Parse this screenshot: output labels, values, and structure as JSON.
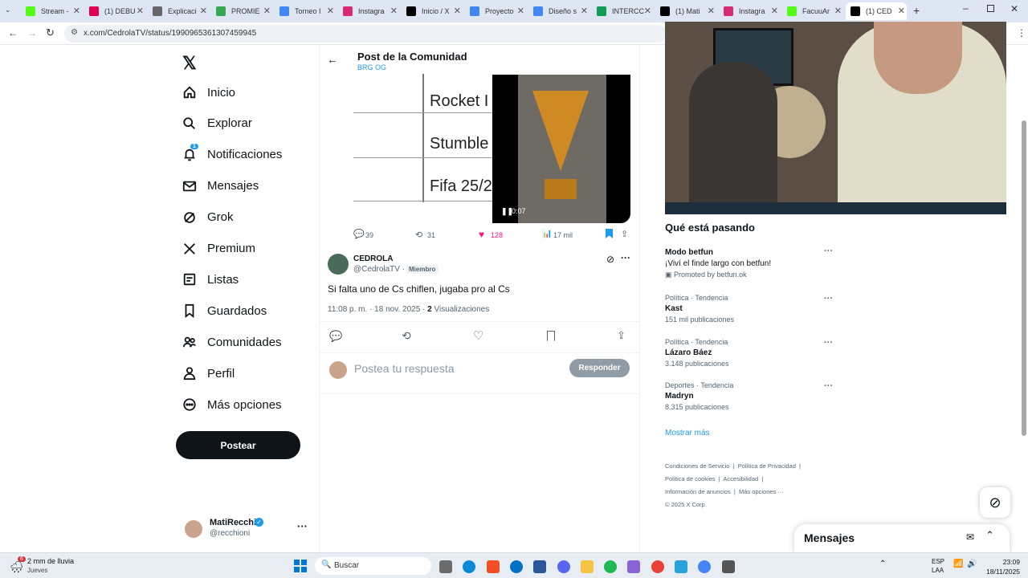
{
  "browser": {
    "tabs": [
      {
        "label": "Stream -",
        "color": "#53fc18"
      },
      {
        "label": "(1) DEBU",
        "color": "#e0004d"
      },
      {
        "label": "Explicaci",
        "color": "#666666"
      },
      {
        "label": "PROMIE",
        "color": "#34a853"
      },
      {
        "label": "Torneo I",
        "color": "#4285f4"
      },
      {
        "label": "Instagra",
        "color": "#d62976"
      },
      {
        "label": "Inicio / X",
        "color": "#000000"
      },
      {
        "label": "Proyecto",
        "color": "#4285f4"
      },
      {
        "label": "Diseño s",
        "color": "#4285f4"
      },
      {
        "label": "INTERCC",
        "color": "#0f9d58"
      },
      {
        "label": "(1) Mati",
        "color": "#000000"
      },
      {
        "label": "Instagra",
        "color": "#d62976"
      },
      {
        "label": "FacuuAr",
        "color": "#53fc18"
      },
      {
        "label": "(1) CED",
        "color": "#000000"
      }
    ],
    "url": "x.com/CedrolaTV/status/1990965361307459945"
  },
  "sidebar": {
    "items": [
      {
        "label": "Inicio",
        "icon": "home-icon"
      },
      {
        "label": "Explorar",
        "icon": "search-icon"
      },
      {
        "label": "Notificaciones",
        "icon": "bell-icon",
        "badge": "1"
      },
      {
        "label": "Mensajes",
        "icon": "mail-icon"
      },
      {
        "label": "Grok",
        "icon": "grok-icon"
      },
      {
        "label": "Premium",
        "icon": "x-icon"
      },
      {
        "label": "Listas",
        "icon": "list-icon"
      },
      {
        "label": "Guardados",
        "icon": "bookmark-icon"
      },
      {
        "label": "Comunidades",
        "icon": "people-icon"
      },
      {
        "label": "Perfil",
        "icon": "person-icon"
      },
      {
        "label": "Más opciones",
        "icon": "more-circle-icon"
      }
    ],
    "post_button": "Postear",
    "account": {
      "name": "MatiRecchi",
      "handle": "@recchioni"
    }
  },
  "header": {
    "title": "Post de la Comunidad",
    "subtitle": "BRG OG"
  },
  "media": {
    "table_rows": [
      "Rocket I",
      "Stumble",
      "Fifa 25/2"
    ],
    "video_time": "0:07"
  },
  "parent_actions": {
    "replies": "39",
    "reposts": "31",
    "likes": "128",
    "views": "17 mil"
  },
  "post": {
    "name": "CEDROLA",
    "handle": "@CedrolaTV",
    "sep": "·",
    "member_badge": "Miembro",
    "text": "Si falta uno de Cs chiflen, jugaba pro al Cs",
    "time": "11:08 p. m. · 18 nov. 2025 ·",
    "views_count": "2",
    "views_label": "Visualizaciones"
  },
  "reply": {
    "placeholder": "Postea tu respuesta",
    "button": "Responder"
  },
  "trends": {
    "title": "Qué está pasando",
    "promo": {
      "name": "Modo betfun",
      "text": "¡Viví el finde largo con betfun!",
      "promoted": "Promoted by betfun.ok"
    },
    "items": [
      {
        "category": "Política · Tendencia",
        "name": "Kast",
        "count": "151 mil publicaciones"
      },
      {
        "category": "Política · Tendencia",
        "name": "Lázaro Báez",
        "count": "3.148 publicaciones"
      },
      {
        "category": "Deportes · Tendencia",
        "name": "Madryn",
        "count": "8.315 publicaciones"
      }
    ],
    "more": "Mostrar más"
  },
  "footer": {
    "links": [
      "Condiciones de Servicio",
      "Política de Privacidad",
      "Política de cookies",
      "Accesibilidad",
      "Información de anuncios",
      "Más opciones ···"
    ],
    "copyright": "© 2025 X Corp."
  },
  "messages_drawer": {
    "title": "Mensajes"
  },
  "taskbar": {
    "weather": "2 mm de lluvia",
    "weather_day": "Jueves",
    "weather_badge": "6",
    "search": "Buscar",
    "lang": "ESP",
    "lang2": "LAA",
    "time": "23:09",
    "date": "18/11/2025"
  }
}
